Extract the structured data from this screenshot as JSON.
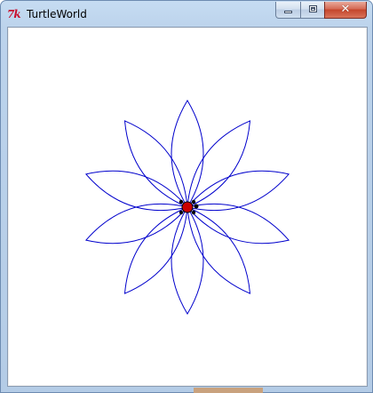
{
  "window": {
    "title": "TurtleWorld",
    "app_icon_text": "7k",
    "close_glyph": "✕"
  },
  "canvas": {
    "background": "#ffffff",
    "drawing": {
      "shape": "flower",
      "petal_count": 10,
      "petal_color": "#0000cc",
      "turtle_color": "#cc0000",
      "turtle_outline": "#000000"
    }
  },
  "colors": {
    "titlebar": "#c6dcf2",
    "close_button": "#c4452b"
  }
}
